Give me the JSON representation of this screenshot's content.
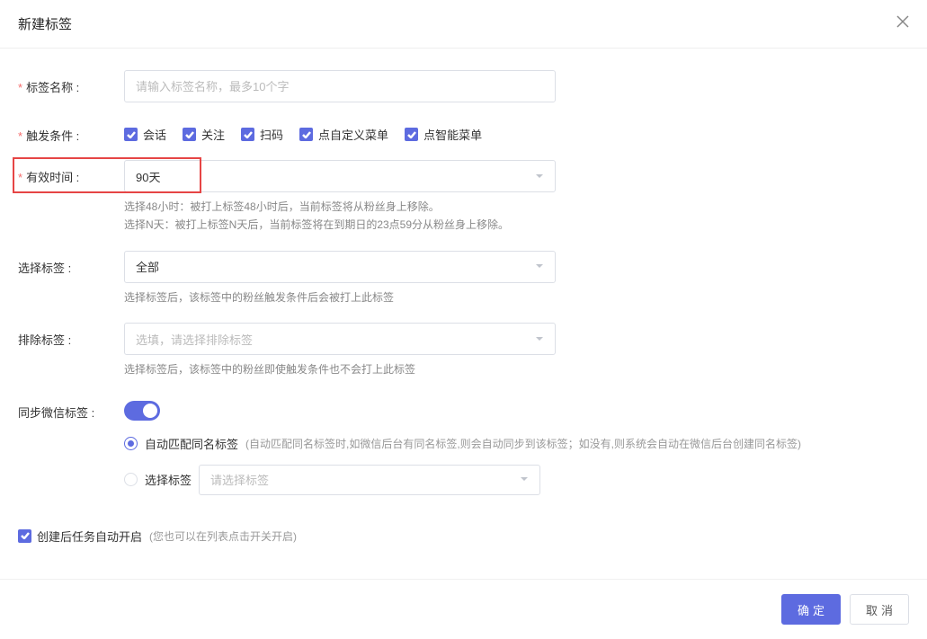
{
  "modal": {
    "title": "新建标签"
  },
  "labels": {
    "tag_name": "标签名称 :",
    "trigger": "触发条件 :",
    "effective": "有效时间 :",
    "select_tag": "选择标签 :",
    "exclude_tag": "排除标签 :",
    "sync_wx": "同步微信标签 :"
  },
  "placeholders": {
    "tag_name": "请输入标签名称，最多10个字",
    "exclude_tag": "选填，请选择排除标签",
    "select_tag_dropdown": "请选择标签"
  },
  "trigger_options": [
    "会话",
    "关注",
    "扫码",
    "点自定义菜单",
    "点智能菜单"
  ],
  "effective": {
    "value": "90天",
    "help1": "选择48小时：被打上标签48小时后，当前标签将从粉丝身上移除。",
    "help2": "选择N天：被打上标签N天后，当前标签将在到期日的23点59分从粉丝身上移除。"
  },
  "select_tag": {
    "value": "全部",
    "help": "选择标签后，该标签中的粉丝触发条件后会被打上此标签"
  },
  "exclude_tag": {
    "help": "选择标签后，该标签中的粉丝即使触发条件也不会打上此标签"
  },
  "sync": {
    "radio1_label": "自动匹配同名标签",
    "radio1_hint": "(自动匹配同名标签时,如微信后台有同名标签,则会自动同步到该标签；如没有,则系统会自动在微信后台创建同名标签)",
    "radio2_label": "选择标签"
  },
  "auto_start": {
    "label": "创建后任务自动开启",
    "hint": "(您也可以在列表点击开关开启)"
  },
  "footer": {
    "confirm": "确定",
    "cancel": "取消"
  }
}
